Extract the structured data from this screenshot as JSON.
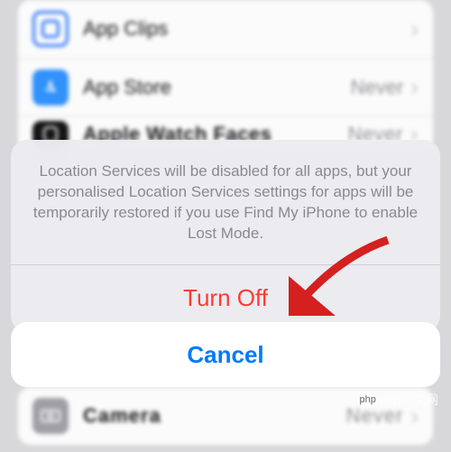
{
  "list": {
    "items": [
      {
        "label": "App Clips",
        "value": ""
      },
      {
        "label": "App Store",
        "value": "Never"
      },
      {
        "label": "Apple Watch Faces",
        "value": "Never"
      }
    ],
    "bottom": {
      "label": "Camera",
      "value": "Never"
    }
  },
  "alert": {
    "message": "Location Services will be disabled for all apps, but your personalised Location Services settings for apps will be temporarily restored if you use Find My iPhone to enable Lost Mode.",
    "destructive_label": "Turn Off",
    "cancel_label": "Cancel"
  },
  "watermark": "php中文网"
}
